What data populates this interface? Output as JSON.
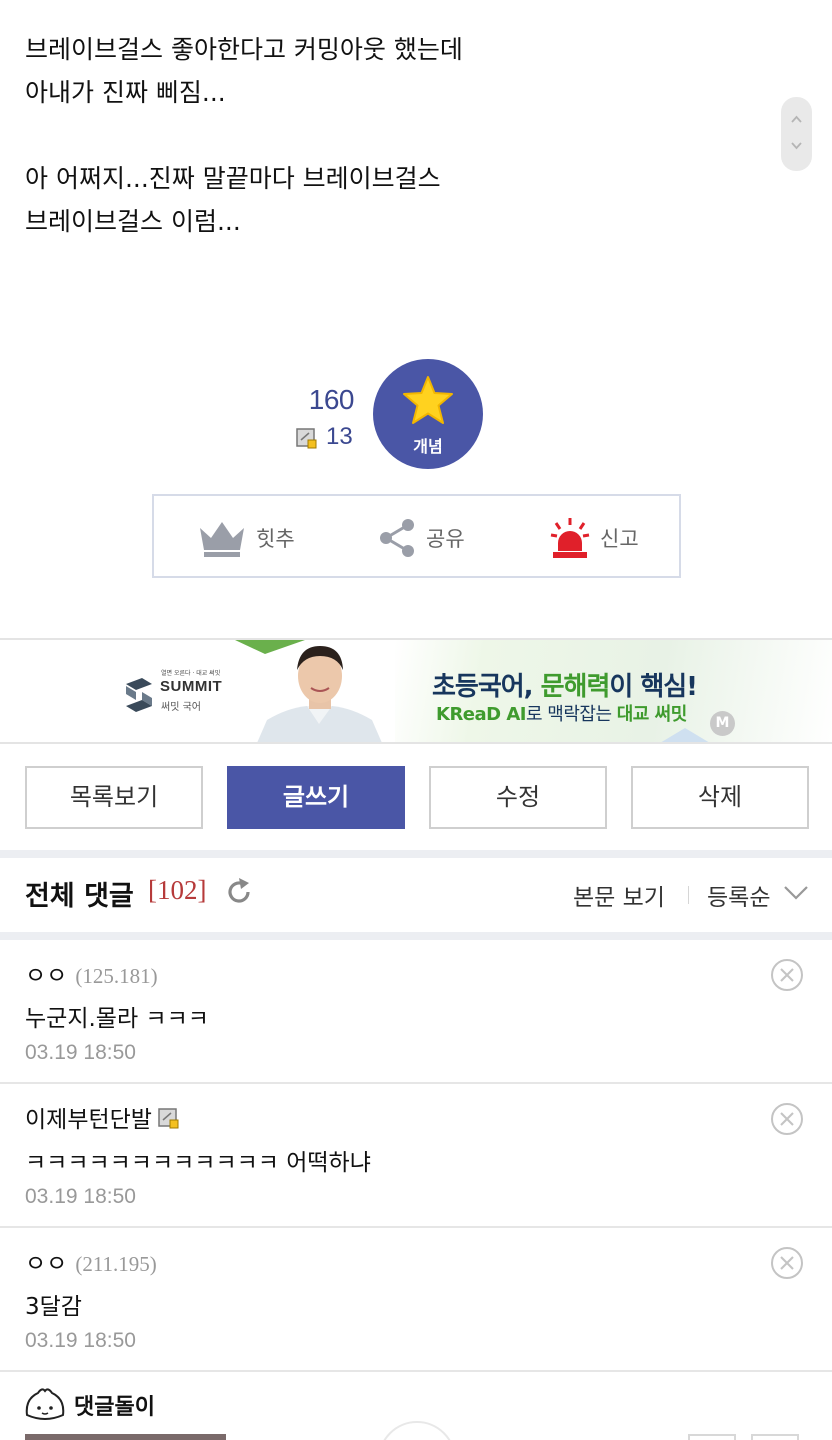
{
  "post": {
    "lines": [
      "브레이브걸스 좋아한다고 커밍아웃 했는데",
      "아내가 진짜 삐짐...",
      "",
      "아 어쩌지...진짜 말끝마다 브레이브걸스",
      "브레이브걸스 이럼..."
    ]
  },
  "vote": {
    "recommend_count": "160",
    "fixed_count": "13",
    "button_label": "개념"
  },
  "actions": {
    "hit": "힛추",
    "share": "공유",
    "report": "신고"
  },
  "ad": {
    "tagline": "열면 오른다 · 대교 써밋",
    "brand": "SUMMIT",
    "brand_sub": "써밋 국어",
    "headline_a": "초등국어, ",
    "headline_b": "문해력",
    "headline_c": "이 핵심!",
    "sub_a": "KReaD AI",
    "sub_b": "로 맥락잡는 ",
    "sub_c": "대교 써밋",
    "badge": "M"
  },
  "buttons": {
    "list": "목록보기",
    "write": "글쓰기",
    "edit": "수정",
    "delete": "삭제"
  },
  "comments_header": {
    "title": "전체 댓글",
    "count": "[102]",
    "view_body": "본문 보기",
    "sort": "등록순"
  },
  "comments": [
    {
      "nick": "ㅇㅇ",
      "ip": "(125.181)",
      "text": "누군지.몰라 ㅋㅋㅋ",
      "time": "03.19 18:50"
    },
    {
      "nick": "이제부턴단발",
      "ip": "",
      "text": "ㅋㅋㅋㅋㅋㅋㅋㅋㅋㅋㅋㅋ 어떡하냐",
      "time": "03.19 18:50"
    },
    {
      "nick": "ㅇㅇ",
      "ip": "(211.195)",
      "text": "3달감",
      "time": "03.19 18:50"
    }
  ],
  "bottom": {
    "label": "댓글돌이"
  },
  "colors": {
    "accent": "#4a56a6",
    "count_red": "#b63a3a",
    "report_red": "#e0202a"
  }
}
